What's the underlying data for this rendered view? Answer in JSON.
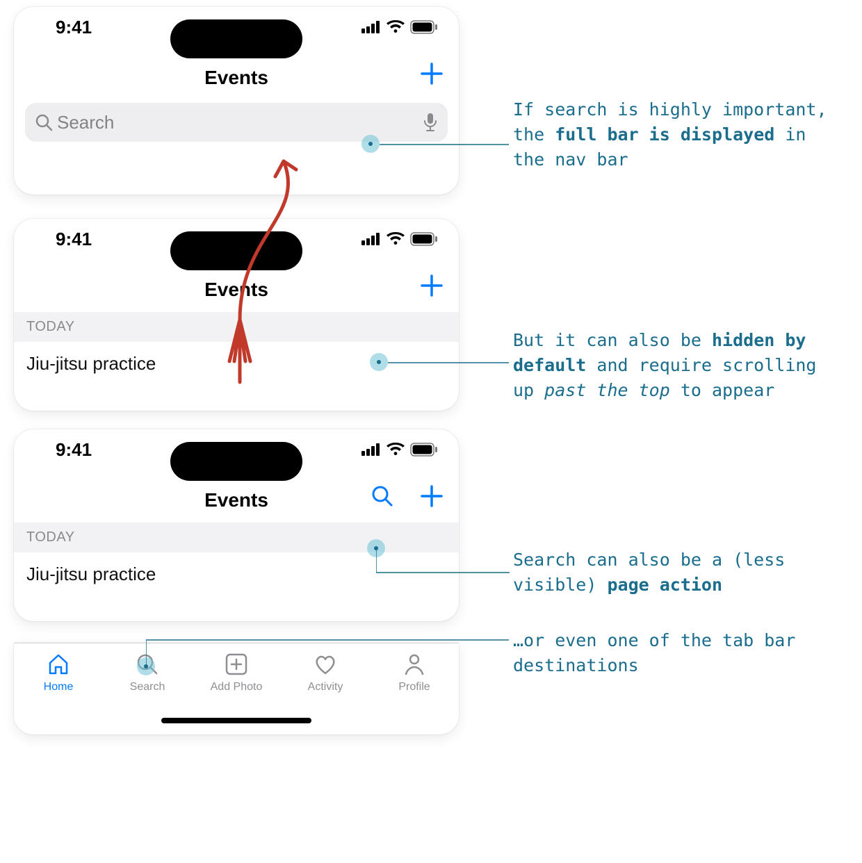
{
  "statusbar": {
    "time": "9:41"
  },
  "nav": {
    "title": "Events"
  },
  "search": {
    "placeholder": "Search"
  },
  "sections": {
    "today": "TODAY"
  },
  "events": {
    "first": "Jiu-jitsu practice"
  },
  "tabs": {
    "home": "Home",
    "search": "Search",
    "addphoto": "Add Photo",
    "activity": "Activity",
    "profile": "Profile"
  },
  "annot": {
    "a1_pre": "If search is highly important, the ",
    "a1_b": "full bar is displayed",
    "a1_post": " in the nav bar",
    "a2_pre": "But it can also be ",
    "a2_b": "hidden by default",
    "a2_mid": " and require scrolling up ",
    "a2_i": "past the top",
    "a2_post": " to appear",
    "a3_pre": "Search can also be a (less visible) ",
    "a3_b": "page action",
    "a4": "…or even one of the tab bar destinations"
  }
}
